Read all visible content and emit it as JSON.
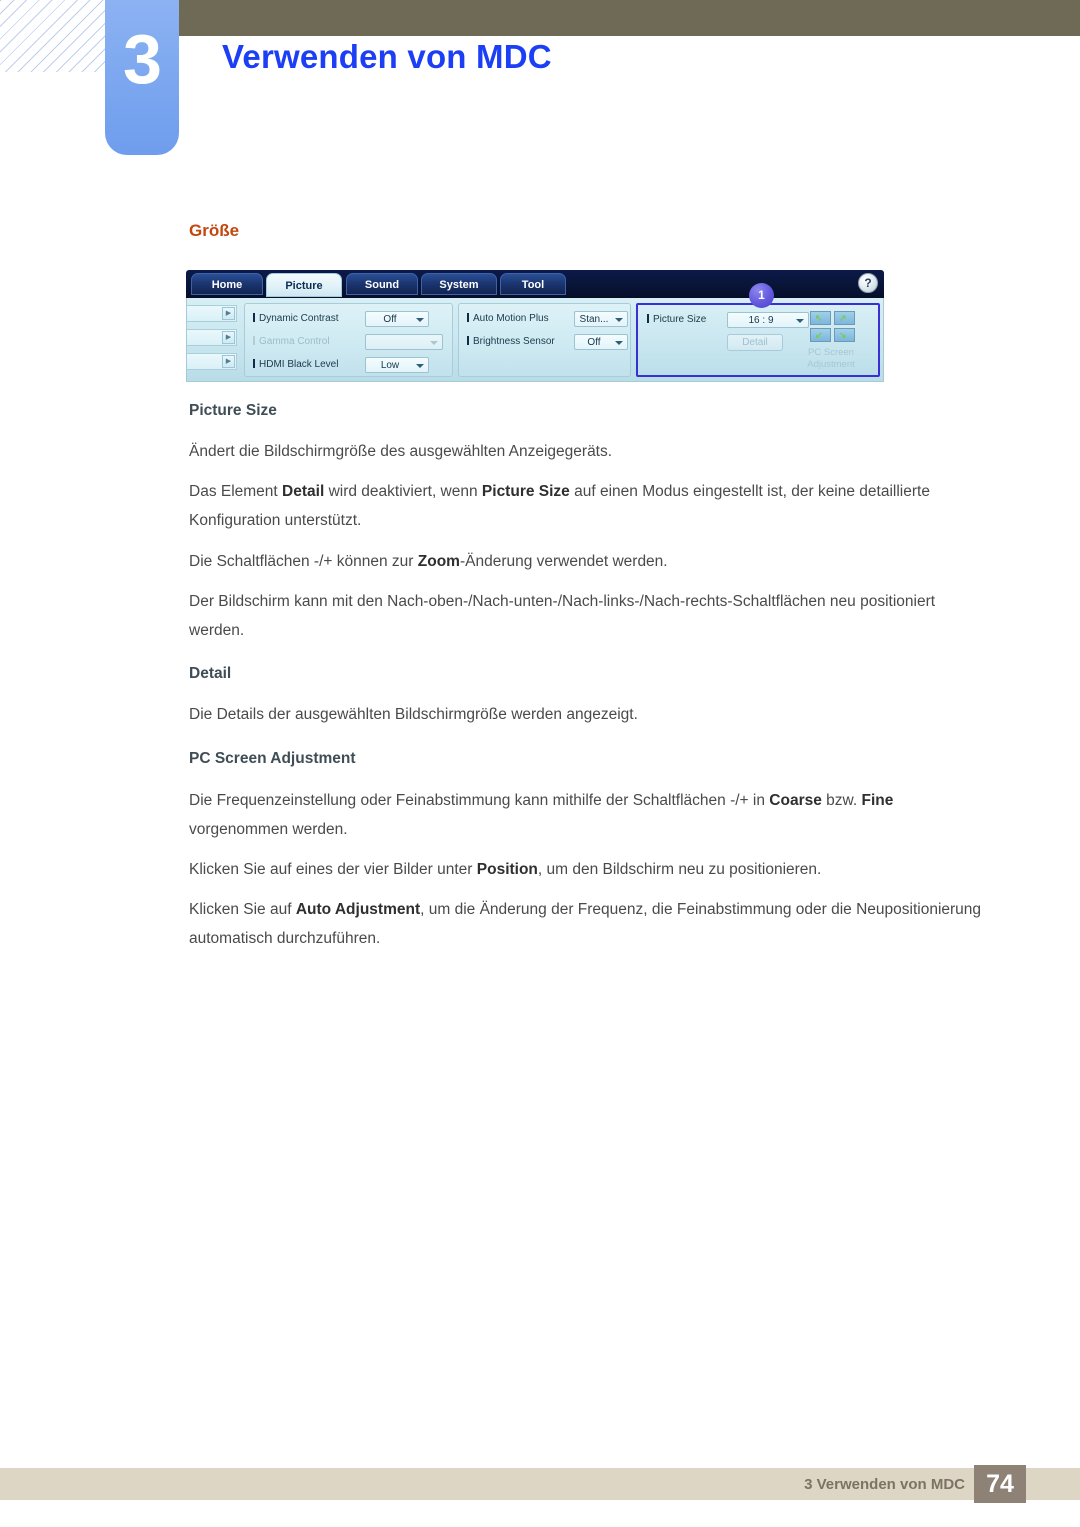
{
  "header": {
    "chapter_number": "3",
    "chapter_title": "Verwenden von MDC"
  },
  "section_heading": "Größe",
  "mdc_screenshot": {
    "tabs": [
      {
        "label": "Home",
        "active": false
      },
      {
        "label": "Picture",
        "active": true
      },
      {
        "label": "Sound",
        "active": false
      },
      {
        "label": "System",
        "active": false
      },
      {
        "label": "Tool",
        "active": false
      }
    ],
    "help_icon": "?",
    "badge": "1",
    "left_group": [
      {
        "label": "Dynamic Contrast",
        "value": "Off",
        "disabled": false
      },
      {
        "label": "Gamma Control",
        "value": "",
        "disabled": true
      },
      {
        "label": "HDMI Black Level",
        "value": "Low",
        "disabled": false
      }
    ],
    "middle_group": [
      {
        "label": "Auto Motion Plus",
        "value": "Stan...",
        "disabled": false
      },
      {
        "label": "Brightness Sensor",
        "value": "Off",
        "disabled": false
      }
    ],
    "right_group": {
      "picture_size_label": "Picture Size",
      "picture_size_value": "16 : 9",
      "detail_button": "Detail",
      "pc_screen_adjustment_line1": "PC Screen",
      "pc_screen_adjustment_line2": "Adjustment",
      "arrow_glyphs": [
        "↖",
        "↗",
        "↙",
        "↘"
      ]
    },
    "stub_arrow": "▶"
  },
  "content": {
    "heading_picture_size": "Picture Size",
    "p1": "Ändert die Bildschirmgröße des ausgewählten Anzeigegeräts.",
    "p2_a": "Das Element ",
    "p2_b1": "Detail",
    "p2_c": " wird deaktiviert, wenn ",
    "p2_b2": "Picture Size",
    "p2_d": " auf einen Modus eingestellt ist, der keine detaillierte Konfiguration unterstützt.",
    "p3_a": "Die Schaltflächen -/+ können zur ",
    "p3_b": "Zoom",
    "p3_c": "-Änderung verwendet werden.",
    "p4": "Der Bildschirm kann mit den Nach-oben-/Nach-unten-/Nach-links-/Nach-rechts-Schaltflächen neu positioniert werden.",
    "heading_detail": "Detail",
    "p5": "Die Details der ausgewählten Bildschirmgröße werden angezeigt.",
    "heading_pc_screen_adjustment": "PC Screen Adjustment",
    "p6_a": "Die Frequenzeinstellung oder Feinabstimmung kann mithilfe der Schaltflächen -/+ in ",
    "p6_b1": "Coarse",
    "p6_c": " bzw. ",
    "p6_b2": "Fine",
    "p6_d": " vorgenommen werden.",
    "p7_a": "Klicken Sie auf eines der vier Bilder unter ",
    "p7_b": "Position",
    "p7_c": ", um den Bildschirm neu zu positionieren.",
    "p8_a": "Klicken Sie auf ",
    "p8_b": "Auto Adjustment",
    "p8_c": ", um die Änderung der Frequenz, die Feinabstimmung oder die Neupositionierung automatisch durchzuführen."
  },
  "footer": {
    "text": "3 Verwenden von MDC",
    "page_number": "74"
  },
  "colors": {
    "chapter_title": "#1c3ff5",
    "section_heading": "#c3480f",
    "header_bar": "#6e6a55",
    "chapter_box": "#7ea9f0",
    "footer_bar": "#ddd6c4",
    "page_box": "#8e8176",
    "highlight_border": "#3a2fd6",
    "badge": "#5b53d6"
  }
}
